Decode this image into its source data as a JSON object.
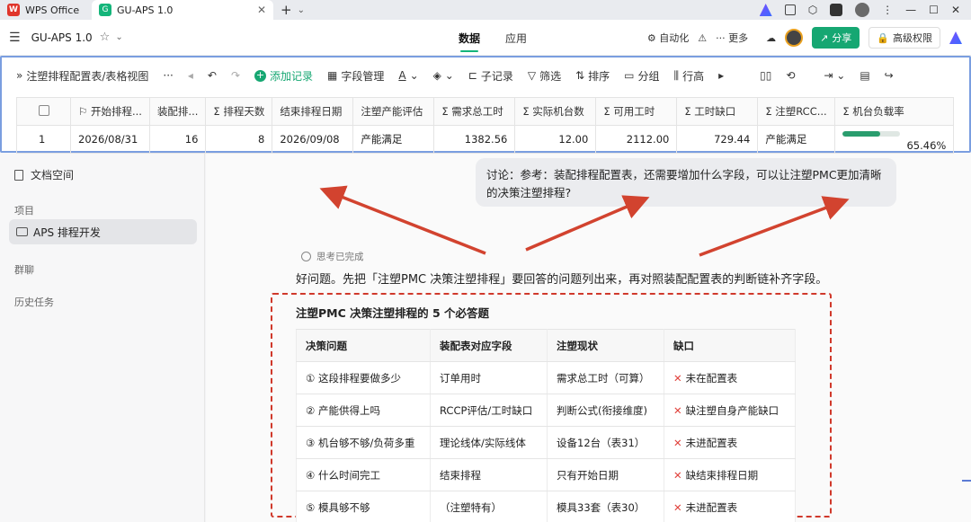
{
  "titlebar": {
    "tabs": [
      {
        "label": "WPS Office",
        "logo": "W"
      },
      {
        "label": "GU-APS 1.0",
        "logo": "G"
      }
    ],
    "close_glyph": "✕",
    "add_glyph": "+",
    "window": {
      "minimize": "—",
      "maximize": "☐",
      "close": "✕"
    }
  },
  "appbar": {
    "title": "GU-APS 1.0",
    "tabs": [
      "数据",
      "应用"
    ],
    "active_tab": "数据",
    "automation": "自动化",
    "more": "更多",
    "share": "分享",
    "permission": "高级权限"
  },
  "toolbar": {
    "view_name": "注塑排程配置表/表格视图",
    "add_record": "添加记录",
    "field_manage": "字段管理",
    "sub_record": "子记录",
    "filter": "筛选",
    "sort": "排序",
    "group": "分组",
    "row_height": "行高"
  },
  "grid": {
    "headers": [
      "开始排程...",
      "装配排...",
      "排程天数",
      "结束排程日期",
      "注塑产能评估",
      "需求总工时",
      "实际机台数",
      "可用工时",
      "工时缺口",
      "注塑RCC...",
      "机台负载率"
    ],
    "row": {
      "index": "1",
      "start_date": "2026/08/31",
      "assembly": "16",
      "days": "8",
      "end_date": "2026/09/08",
      "capacity_eval": "产能满足",
      "demand_hours": "1382.56",
      "machines": "12.00",
      "available_hours": "2112.00",
      "hour_gap": "729.44",
      "rcc": "产能满足",
      "load_rate": "65.46%",
      "load_fraction": 0.6546
    }
  },
  "sidebar": {
    "doc_space": "文档空间",
    "projects_label": "项目",
    "active_project": "APS 排程开发",
    "group_chat": "群聊",
    "history": "历史任务"
  },
  "chat": {
    "question": "讨论：参考：装配排程配置表，还需要增加什么字段，可以让注塑PMC更加清晰的决策注塑排程?",
    "thinking": "思考已完成",
    "answer_intro": "好问题。先把「注塑PMC 决策注塑排程」要回答的问题列出来，再对照装配配置表的判断链补齐字段。",
    "box_title": "注塑PMC 决策注塑排程的 5 个必答题",
    "table_headers": [
      "决策问题",
      "装配表对应字段",
      "注塑现状",
      "缺口"
    ],
    "rows": [
      [
        "① 这段排程要做多少",
        "订单用时",
        "需求总工时（可算）",
        "未在配置表"
      ],
      [
        "② 产能供得上吗",
        "RCCP评估/工时缺口",
        "判断公式(衔接维度)",
        "缺注塑自身产能缺口"
      ],
      [
        "③ 机台够不够/负荷多重",
        "理论线体/实际线体",
        "设备12台（表31）",
        "未进配置表"
      ],
      [
        "④ 什么时间完工",
        "结束排程",
        "只有开始日期",
        "缺结束排程日期"
      ],
      [
        "⑤ 模具够不够",
        "（注塑特有）",
        "模具33套（表30）",
        "未进配置表"
      ]
    ]
  }
}
